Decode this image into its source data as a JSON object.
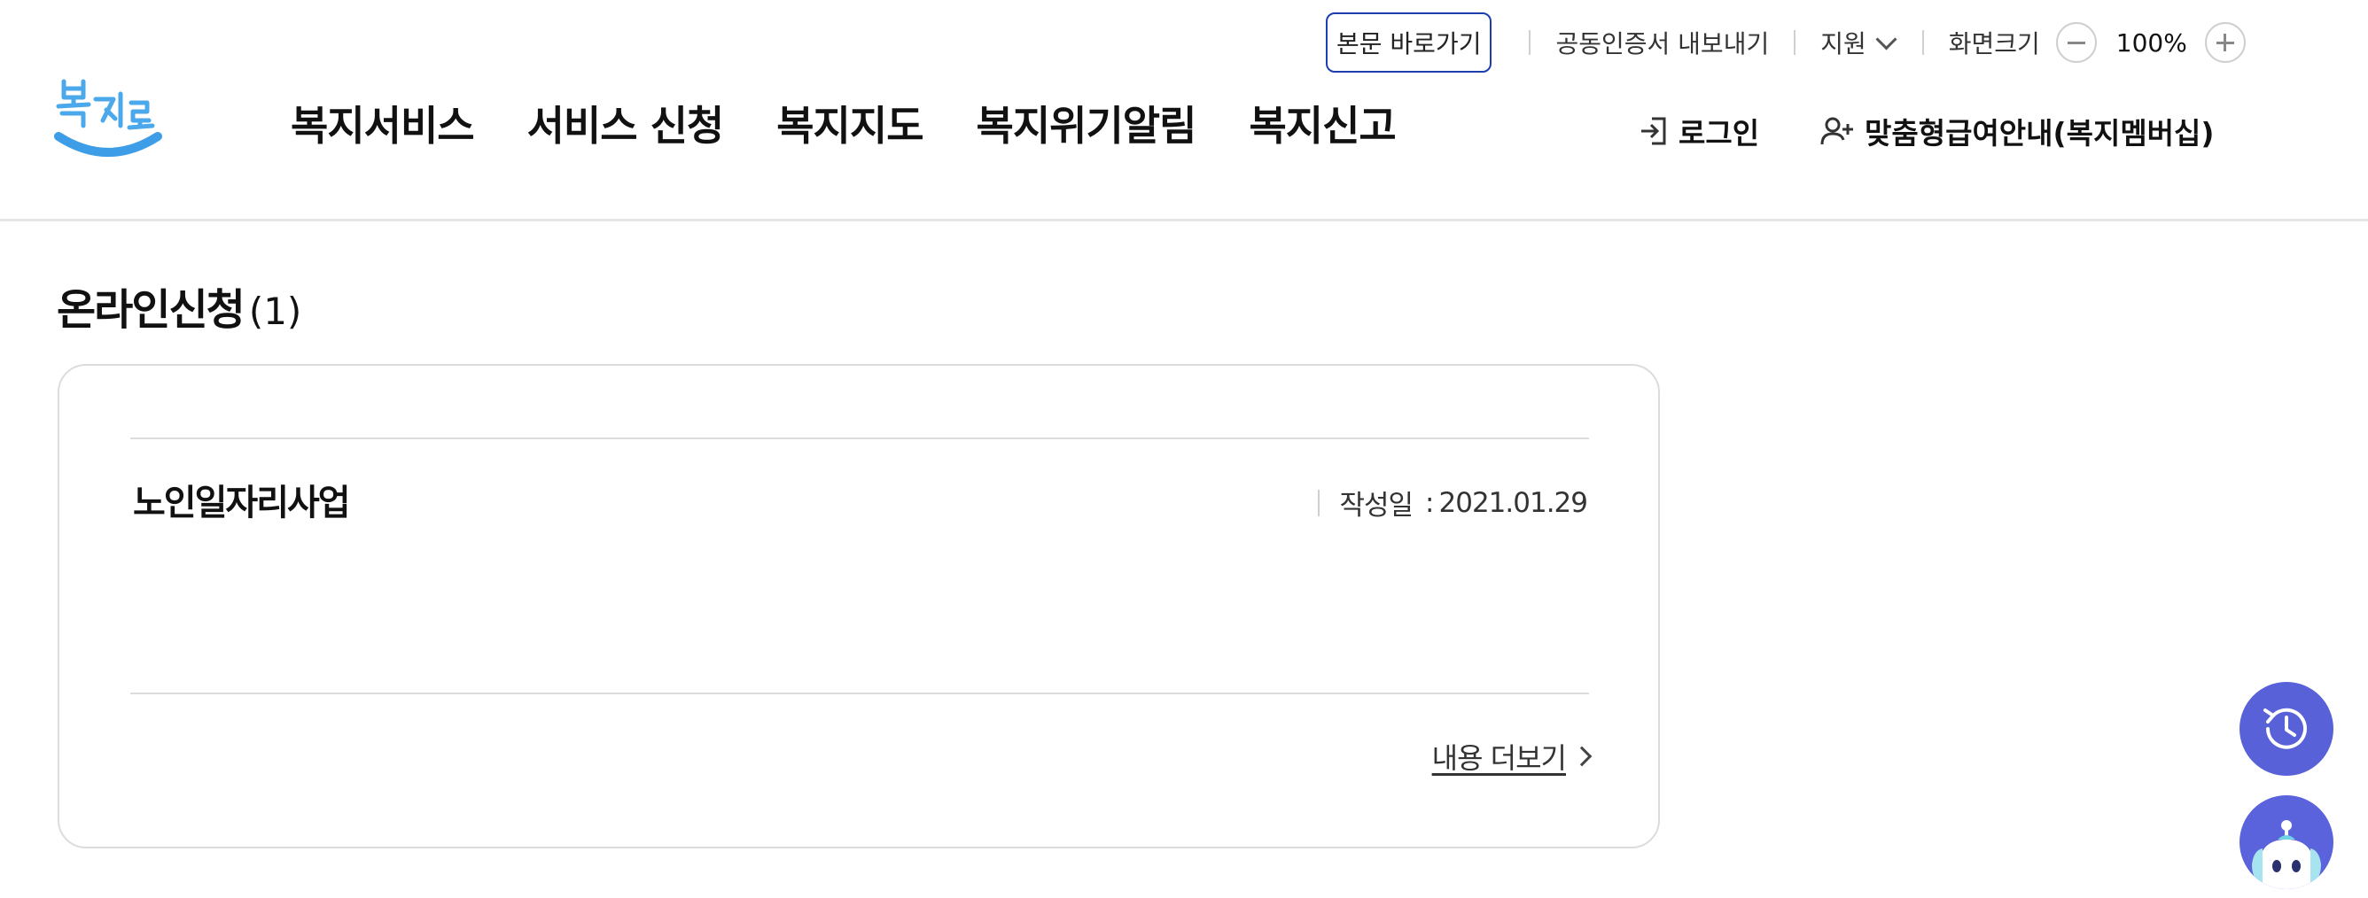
{
  "topbar": {
    "skip_link": "본문 바로가기",
    "cert_export": "공동인증서 내보내기",
    "support": "지원",
    "screen_size_label": "화면크기",
    "zoom_value": "100%",
    "zoom_out_icon": "minus-icon",
    "zoom_in_icon": "plus-icon"
  },
  "logo": {
    "text": "복지로",
    "colors": {
      "text": "#4ba8ea",
      "smile": "#3d9de6"
    }
  },
  "gnb": {
    "items": [
      {
        "label": "복지서비스"
      },
      {
        "label": "서비스 신청"
      },
      {
        "label": "복지지도"
      },
      {
        "label": "복지위기알림"
      },
      {
        "label": "복지신고"
      }
    ]
  },
  "member": {
    "login": "로그인",
    "membership": "맞춤형급여안내(복지멤버십)"
  },
  "section": {
    "title": "온라인신청",
    "count": "(1)"
  },
  "items": [
    {
      "title": "노인일자리사업",
      "date_label": "작성일",
      "date_sep": ":",
      "date": "2021.01.29",
      "more": "내용 더보기"
    }
  ],
  "float_buttons": {
    "history_icon": "history-icon",
    "chatbot_icon": "chatbot-icon"
  },
  "colors": {
    "accent": "#1d3fae",
    "float": "#5861d8",
    "border": "#dcdcdc"
  }
}
